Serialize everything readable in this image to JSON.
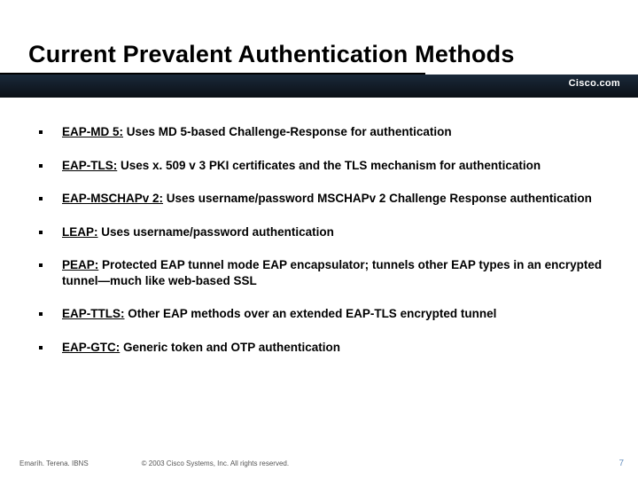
{
  "title": "Current Prevalent Authentication Methods",
  "brand": "Cisco.com",
  "bullets": [
    {
      "term": "EAP-MD 5:",
      "rest": " Uses MD 5-based Challenge-Response for authentication"
    },
    {
      "term": "EAP-TLS:",
      "rest": " Uses x. 509 v 3 PKI certificates and the TLS mechanism for authentication"
    },
    {
      "term": "EAP-MSCHAPv 2:",
      "rest": " Uses username/password MSCHAPv 2 Challenge Response authentication"
    },
    {
      "term": "LEAP:",
      "rest": " Uses username/password authentication"
    },
    {
      "term": "PEAP:",
      "rest": " Protected EAP tunnel mode EAP encapsulator; tunnels other EAP types in an encrypted tunnel—much like web-based SSL"
    },
    {
      "term": "EAP-TTLS:",
      "rest": " Other EAP methods over an extended EAP-TLS encrypted tunnel"
    },
    {
      "term": "EAP-GTC:",
      "rest": " Generic token and OTP authentication"
    }
  ],
  "footer": {
    "left": "Emaríh. Terena. IBNS",
    "center": "© 2003 Cisco Systems, Inc. All rights reserved.",
    "page": "7"
  }
}
